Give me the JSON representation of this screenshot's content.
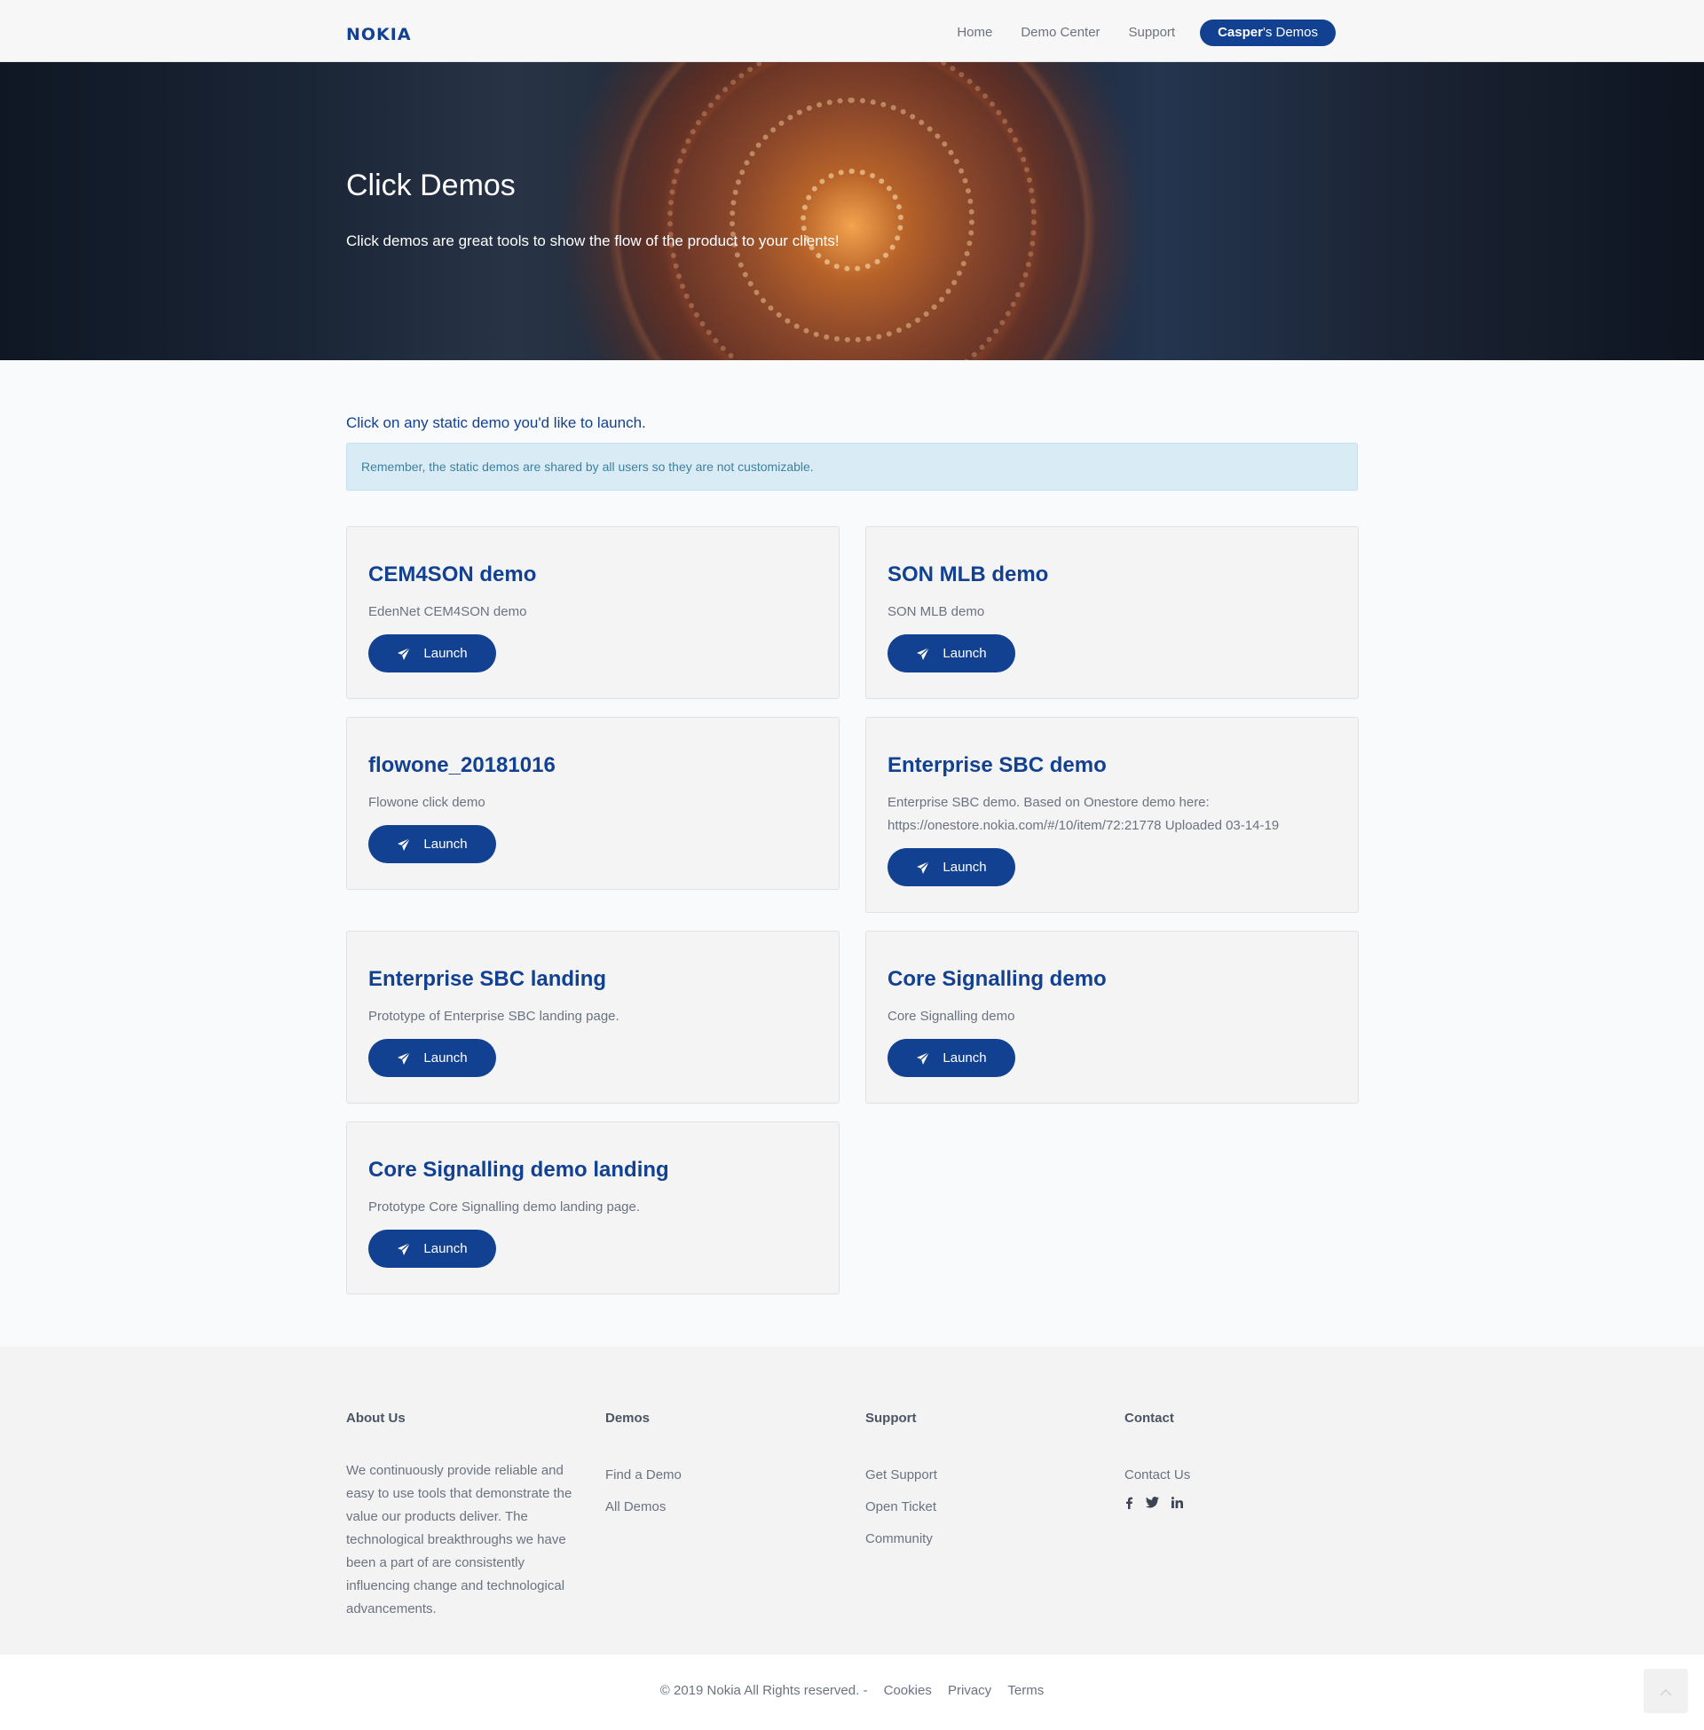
{
  "brand": {
    "logo": "NOKIA"
  },
  "nav": {
    "home": "Home",
    "demo_center": "Demo Center",
    "support": "Support",
    "user_name": "Casper",
    "user_suffix": "'s Demos"
  },
  "hero": {
    "title": "Click Demos",
    "subtitle": "Click demos are great tools to show the flow of the product to your clients!"
  },
  "main": {
    "intro": "Click on any static demo you'd like to launch.",
    "alert": "Remember, the static demos are shared by all users so they are not customizable.",
    "launch_label": "Launch",
    "launch_icon": "paper-plane-icon",
    "cards": [
      {
        "title": "CEM4SON demo",
        "description": "EdenNet CEM4SON demo"
      },
      {
        "title": "SON MLB demo",
        "description": "SON MLB demo"
      },
      {
        "title": "flowone_20181016",
        "description": "Flowone click demo"
      },
      {
        "title": "Enterprise SBC demo",
        "description": "Enterprise SBC demo. Based on Onestore demo here: https://onestore.nokia.com/#/10/item/72:21778 Uploaded 03-14-19"
      },
      {
        "title": "Enterprise SBC landing",
        "description": "Prototype of Enterprise SBC landing page."
      },
      {
        "title": "Core Signalling demo",
        "description": "Core Signalling demo"
      },
      {
        "title": "Core Signalling demo landing",
        "description": "Prototype Core Signalling demo landing page."
      }
    ]
  },
  "footer": {
    "about": {
      "heading": "About Us",
      "text": "We continuously provide reliable and easy to use tools that demonstrate the value our products deliver. The technological breakthroughs we have been a part of are consistently influencing change and technological advancements."
    },
    "demos": {
      "heading": "Demos",
      "links": [
        "Find a Demo",
        "All Demos"
      ]
    },
    "support": {
      "heading": "Support",
      "links": [
        "Get Support",
        "Open Ticket",
        "Community"
      ]
    },
    "contact": {
      "heading": "Contact",
      "links": [
        "Contact Us"
      ],
      "social_icons": [
        "facebook-icon",
        "twitter-icon",
        "linkedin-icon"
      ]
    }
  },
  "bottom": {
    "copyright": "© 2019 Nokia All Rights reserved. -",
    "cookies": "Cookies",
    "privacy": "Privacy",
    "terms": "Terms"
  },
  "colors": {
    "brand_blue": "#124191",
    "alert_bg": "#d9ecf5",
    "card_bg": "#f4f4f5"
  }
}
